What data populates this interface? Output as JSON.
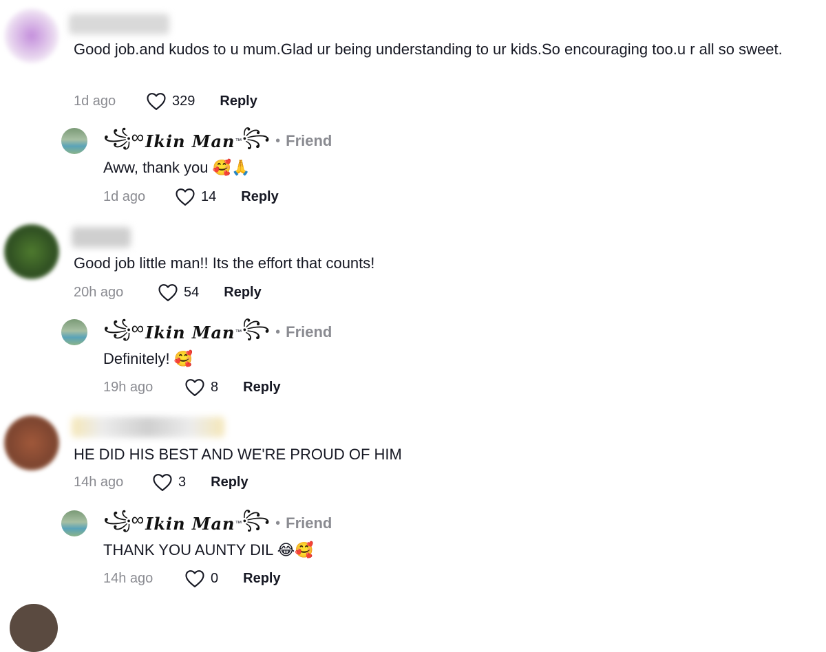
{
  "comments": [
    {
      "text": "Good job.and kudos to u mum.Glad ur being understanding to ur kids.So encouraging too.u r all so sweet.",
      "time": "1d ago",
      "likes": "329",
      "reply": "Reply",
      "avatar_color": "#c9a3d6",
      "replies": [
        {
          "author": "Ikin Man",
          "tm": "™",
          "friend": "Friend",
          "text": "Aww, thank you 🥰🙏",
          "time": "1d ago",
          "likes": "14",
          "reply": "Reply"
        }
      ]
    },
    {
      "text": "Good job little man!! Its the effort that counts!",
      "time": "20h ago",
      "likes": "54",
      "reply": "Reply",
      "avatar_color": "#4f6e2d",
      "replies": [
        {
          "author": "Ikin Man",
          "tm": "™",
          "friend": "Friend",
          "text": "Definitely! 🥰",
          "time": "19h ago",
          "likes": "8",
          "reply": "Reply"
        }
      ]
    },
    {
      "text": "HE DID HIS BEST AND WE'RE PROUD OF HIM",
      "time": "14h ago",
      "likes": "3",
      "reply": "Reply",
      "avatar_color": "#9b5a3c",
      "replies": [
        {
          "author": "Ikin Man",
          "tm": "™",
          "friend": "Friend",
          "text": "THANK YOU AUNTY DIL 😂🥰",
          "time": "14h ago",
          "likes": "0",
          "reply": "Reply"
        }
      ]
    }
  ],
  "colors": {
    "meta_gray": "#8a8b91",
    "text": "#161823",
    "friend_gray": "#8a8b91"
  },
  "icons": {
    "like": "heart-outline-icon"
  }
}
